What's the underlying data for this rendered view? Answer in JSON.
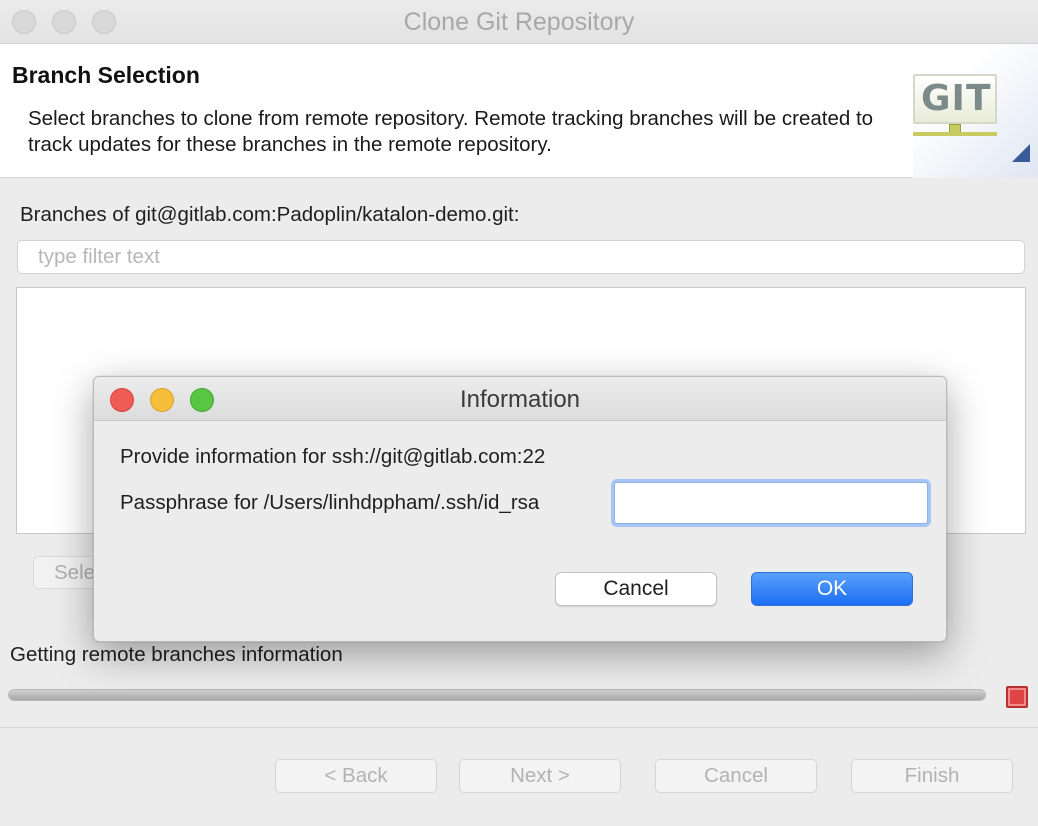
{
  "window": {
    "title": "Clone Git Repository"
  },
  "header": {
    "title": "Branch Selection",
    "description": "Select branches to clone from remote repository. Remote tracking branches will be created to track updates for these branches in the remote repository.",
    "logo_text": "GIT"
  },
  "branches": {
    "label": "Branches of git@gitlab.com:Padoplin/katalon-demo.git:",
    "filter_placeholder": "type filter text",
    "filter_value": "",
    "select_button_label": "Sele",
    "items": []
  },
  "progress": {
    "text": "Getting remote branches information",
    "value_percent": 100
  },
  "footer": {
    "back_label": "< Back",
    "next_label": "Next >",
    "cancel_label": "Cancel",
    "finish_label": "Finish"
  },
  "dialog": {
    "title": "Information",
    "info_text": "Provide information for ssh://git@gitlab.com:22",
    "passphrase_label": "Passphrase for /Users/linhdppham/.ssh/id_rsa",
    "passphrase_value": "",
    "cancel_label": "Cancel",
    "ok_label": "OK"
  },
  "colors": {
    "ok_button": "#1b6ef3",
    "close_light": "#ee5c55",
    "minimize_light": "#f6be3b",
    "maximize_light": "#5ac443",
    "stop_button": "#e04545"
  }
}
